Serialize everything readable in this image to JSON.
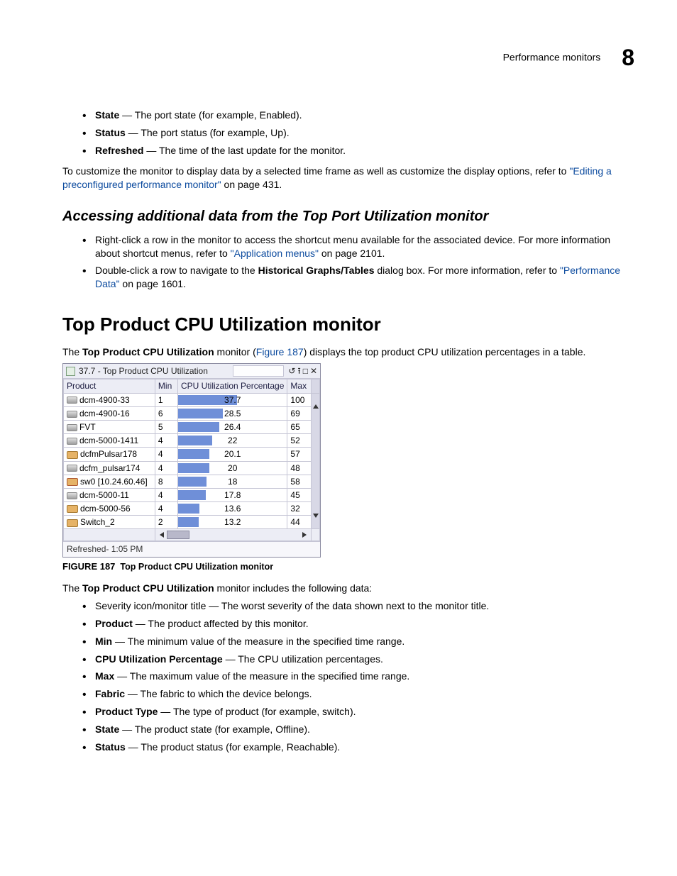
{
  "header": {
    "section": "Performance monitors",
    "chapter": "8"
  },
  "intro_bullets": [
    {
      "term": "State",
      "desc": " — The port state (for example, Enabled)."
    },
    {
      "term": "Status",
      "desc": " — The port status (for example, Up)."
    },
    {
      "term": "Refreshed",
      "desc": " — The time of the last update for the monitor."
    }
  ],
  "customize_para": {
    "pre": "To customize the monitor to display data by a selected time frame as well as customize the display options, refer to ",
    "link": "\"Editing a preconfigured performance monitor\"",
    "post": " on page 431."
  },
  "sub_head": "Accessing additional data from the Top Port Utilization monitor",
  "access_bullets": [
    {
      "pre": "Right-click a row in the monitor to access the shortcut menu available for the associated device. For more information about shortcut menus, refer to ",
      "link": "\"Application menus\"",
      "post": " on page 2101."
    },
    {
      "pre": "Double-click a row to navigate to the ",
      "bold": "Historical Graphs/Tables",
      "mid": " dialog box. For more information, refer to ",
      "link": "\"Performance Data\"",
      "post": " on page 1601."
    }
  ],
  "main_head": "Top Product CPU Utilization monitor",
  "intro2": {
    "a": "The ",
    "b": "Top Product CPU Utilization",
    "c": " monitor (",
    "link": "Figure 187",
    "d": ") displays the top product CPU utilization percentages in a table."
  },
  "chart_data": {
    "type": "table",
    "title": "37.7 - Top Product CPU Utilization",
    "columns": [
      "Product",
      "Min",
      "CPU Utilization Percentage",
      "Max"
    ],
    "bar_axis_max": 100,
    "rows": [
      {
        "icon": "grey",
        "product": "dcm-4900-33",
        "min": 1,
        "pct": 37.7,
        "max": 100
      },
      {
        "icon": "grey",
        "product": "dcm-4900-16",
        "min": 6,
        "pct": 28.5,
        "max": 69
      },
      {
        "icon": "grey",
        "product": "FVT",
        "min": 5,
        "pct": 26.4,
        "max": 65
      },
      {
        "icon": "grey",
        "product": "dcm-5000-1411",
        "min": 4,
        "pct": 22,
        "max": 52
      },
      {
        "icon": "orange",
        "product": "dcfmPulsar178",
        "min": 4,
        "pct": 20.1,
        "max": 57
      },
      {
        "icon": "grey",
        "product": "dcfm_pulsar174",
        "min": 4,
        "pct": 20,
        "max": 48
      },
      {
        "icon": "red",
        "product": "sw0 [10.24.60.46]",
        "min": 8,
        "pct": 18,
        "max": 58
      },
      {
        "icon": "grey",
        "product": "dcm-5000-11",
        "min": 4,
        "pct": 17.8,
        "max": 45
      },
      {
        "icon": "orange",
        "product": "dcm-5000-56",
        "min": 4,
        "pct": 13.6,
        "max": 32
      },
      {
        "icon": "orange2",
        "product": "Switch_2",
        "min": 2,
        "pct": 13.2,
        "max": 44
      }
    ],
    "status": "Refreshed- 1:05 PM"
  },
  "fig_caption": {
    "label": "FIGURE 187",
    "title": "Top Product CPU Utilization monitor"
  },
  "includes_para": {
    "a": "The ",
    "b": "Top Product CPU Utilization",
    "c": " monitor includes the following data:"
  },
  "data_bullets": [
    {
      "term": "",
      "desc": "Severity icon/monitor title — The worst severity of the data shown next to the monitor title."
    },
    {
      "term": "Product",
      "desc": " — The product affected by this monitor."
    },
    {
      "term": "Min",
      "desc": " — The minimum value of the measure in the specified time range."
    },
    {
      "term": "CPU Utilization Percentage",
      "desc": " — The CPU utilization percentages."
    },
    {
      "term": "Max",
      "desc": " — The maximum value of the measure in the specified time range."
    },
    {
      "term": "Fabric",
      "desc": " — The fabric to which the device belongs."
    },
    {
      "term": "Product Type",
      "desc": " — The type of product (for example, switch)."
    },
    {
      "term": "State",
      "desc": " — The product state (for example, Offline)."
    },
    {
      "term": "Status",
      "desc": " — The product status (for example, Reachable)."
    }
  ]
}
